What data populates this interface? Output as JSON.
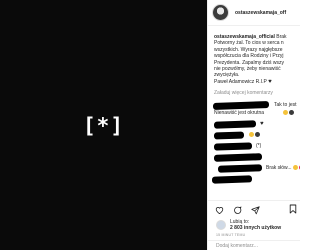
{
  "media": {
    "logo_text": "[*]"
  },
  "header": {
    "username": "ostaszewskamaja_off"
  },
  "caption": {
    "username": "ostaszewskamaja_official",
    "lines": [
      " Brak",
      "Potworny żal. To cios w serca n",
      "wszystkich. Wyrazy najgłębsze",
      "współczucia dla Rodziny i Przyj",
      "Prezydenta. Zapalmy dziś wszy",
      "nie pozwólmy, żeby nienawiść",
      "zwyciężyła.",
      "Paweł Adamowicz R.I.P"
    ]
  },
  "load_more": "Załaduj więcej komentarzy",
  "comments": [
    {
      "text": "Tak to jest",
      "emoji": ""
    },
    {
      "text": "Nienawiść jest okrutna",
      "emoji": "sad-dark"
    },
    {
      "text": "",
      "emoji": "heart"
    },
    {
      "text": "",
      "emoji": "sad-dark"
    },
    {
      "text": "(*)",
      "emoji": ""
    },
    {
      "text": "",
      "emoji": ""
    },
    {
      "text": "Brak słów...",
      "emoji": "sad-red"
    },
    {
      "text": "",
      "emoji": ""
    }
  ],
  "likes": {
    "prefix": "Lubią to:",
    "count_text": "2 803 innych użytkow"
  },
  "timestamp": "15 MINUT TEMU",
  "add_comment_placeholder": "Dodaj komentarz..."
}
